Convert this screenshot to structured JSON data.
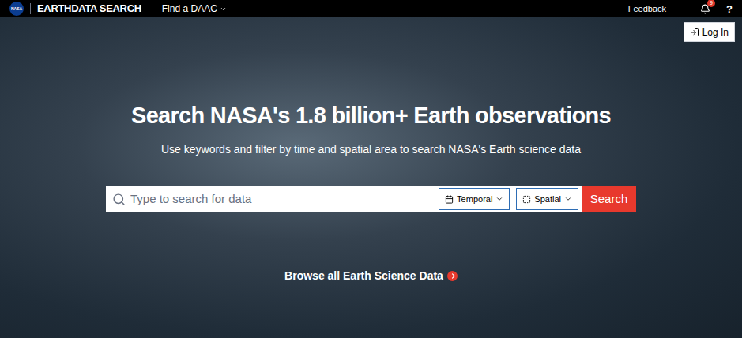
{
  "header": {
    "logo": "NASA",
    "title": "EARTHDATA SEARCH",
    "menu": [
      {
        "label": "Find a DAAC",
        "expanded": false
      }
    ],
    "feedback": "Feedback",
    "notifications": "9",
    "help": "?",
    "login": "Log In"
  },
  "hero": {
    "title": "Search NASA's 1.8 billion+ Earth observations",
    "subtitle": "Use keywords and filter by time and spatial area to search NASA's Earth science data",
    "search": {
      "placeholder": "Type to search for data",
      "filters": [
        "Temporal",
        "Spatial"
      ],
      "button": "Search"
    },
    "browse": "Browse all Earth Science Data"
  }
}
